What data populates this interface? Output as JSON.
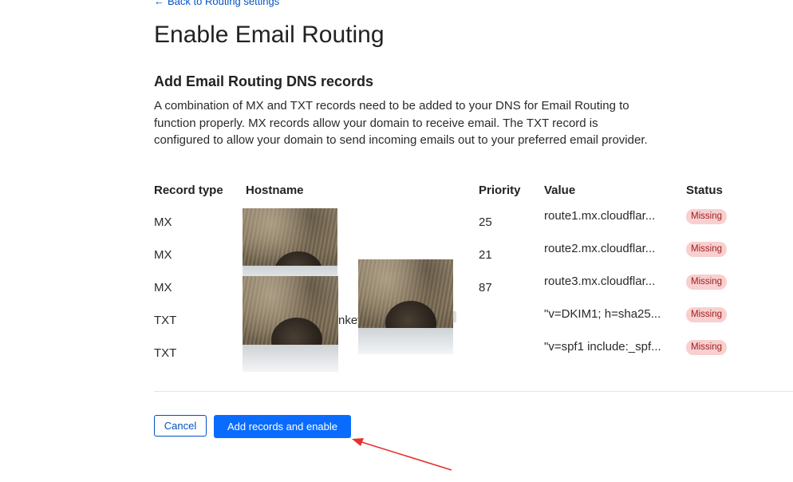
{
  "back_link": "Back to Routing settings",
  "page_title": "Enable Email Routing",
  "section": {
    "title": "Add Email Routing DNS records",
    "description": "A combination of MX and TXT records need to be added to your DNS for Email Routing to function properly. MX records allow your domain to receive email. The TXT record is configured to allow your domain to send incoming emails out to your preferred email provider."
  },
  "table": {
    "headers": [
      "Record type",
      "Hostname",
      "Priority",
      "Value",
      "Status"
    ],
    "rows": [
      {
        "type": "MX",
        "hostname": "",
        "priority": "25",
        "value": "route1.mx.cloudflar...",
        "status": "Missing"
      },
      {
        "type": "MX",
        "hostname": "",
        "priority": "21",
        "value": "route2.mx.cloudflar...",
        "status": "Missing"
      },
      {
        "type": "MX",
        "hostname": "",
        "priority": "87",
        "value": "route3.mx.cloudflar...",
        "status": "Missing"
      },
      {
        "type": "TXT",
        "hostname": "nkey",
        "priority": "",
        "value": "\"v=DKIM1; h=sha25...",
        "status": "Missing"
      },
      {
        "type": "TXT",
        "hostname": "",
        "priority": "",
        "value": "\"v=spf1 include:_spf...",
        "status": "Missing"
      }
    ]
  },
  "buttons": {
    "cancel": "Cancel",
    "primary": "Add records and enable"
  },
  "colors": {
    "accent": "#0a6cff",
    "link": "#0051c3",
    "badge_bg": "#f8d0d0",
    "badge_text": "#9e1b1b",
    "annotation_arrow": "#e5322d"
  }
}
